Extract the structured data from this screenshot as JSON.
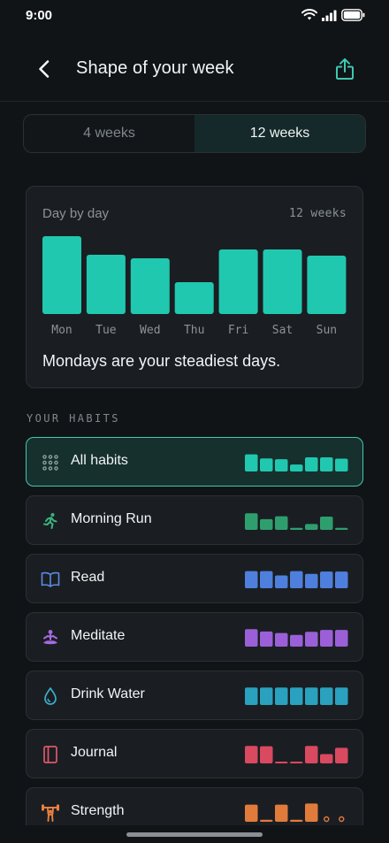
{
  "status": {
    "time": "9:00"
  },
  "header": {
    "title": "Shape of your week"
  },
  "segment": {
    "options": [
      "4 weeks",
      "12 weeks"
    ],
    "selected": 1
  },
  "accent": "#21c8b0",
  "day_card": {
    "label": "Day by day",
    "range": "12 weeks",
    "insight": "Mondays are your steadiest days."
  },
  "chart_data": {
    "type": "bar",
    "categories": [
      "Mon",
      "Tue",
      "Wed",
      "Thu",
      "Fri",
      "Sat",
      "Sun"
    ],
    "values": [
      88,
      67,
      63,
      36,
      73,
      73,
      66
    ],
    "ylim": [
      0,
      100
    ],
    "color": "#21c8b0"
  },
  "habits_section": {
    "label": "YOUR HABITS"
  },
  "habits": [
    {
      "name": "All habits",
      "icon": "grid-dots-icon",
      "color": "#21c8b0",
      "active": true,
      "pattern": [
        88,
        67,
        63,
        36,
        73,
        73,
        66
      ]
    },
    {
      "name": "Morning Run",
      "icon": "running-icon",
      "color": "#2f9e6e",
      "active": false,
      "pattern": [
        85,
        55,
        70,
        10,
        30,
        68,
        10
      ]
    },
    {
      "name": "Read",
      "icon": "book-icon",
      "color": "#4f7fdc",
      "active": false,
      "pattern": [
        88,
        88,
        66,
        88,
        74,
        86,
        86
      ]
    },
    {
      "name": "Meditate",
      "icon": "meditation-icon",
      "color": "#9b5fd8",
      "active": false,
      "pattern": [
        90,
        78,
        70,
        60,
        76,
        86,
        86
      ]
    },
    {
      "name": "Drink Water",
      "icon": "water-drop-icon",
      "color": "#2aa1be",
      "active": false,
      "pattern": [
        90,
        90,
        90,
        90,
        90,
        90,
        90
      ]
    },
    {
      "name": "Journal",
      "icon": "journal-icon",
      "color": "#d9495f",
      "active": false,
      "pattern": [
        90,
        88,
        8,
        8,
        90,
        48,
        80
      ]
    },
    {
      "name": "Strength",
      "icon": "dumbbell-icon",
      "color": "#e07b3c",
      "active": false,
      "pattern": [
        88,
        10,
        88,
        10,
        94,
        0,
        0
      ]
    }
  ]
}
